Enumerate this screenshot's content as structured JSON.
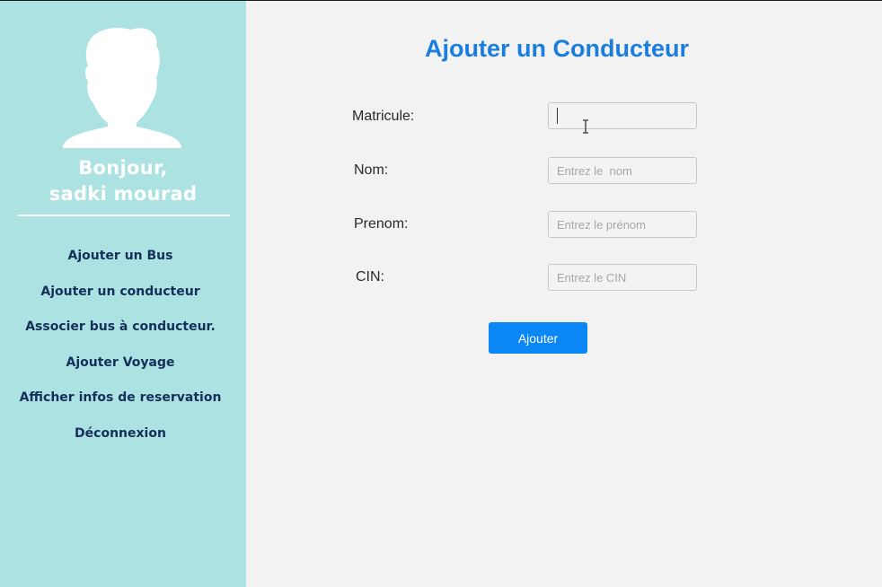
{
  "sidebar": {
    "avatar_icon": "user-silhouette-icon",
    "greeting_line1": "Bonjour,",
    "greeting_line2": "sadki mourad",
    "items": [
      {
        "label": "Ajouter un Bus"
      },
      {
        "label": "Ajouter un conducteur"
      },
      {
        "label": "Associer bus à conducteur."
      },
      {
        "label": "Ajouter Voyage"
      },
      {
        "label": "Afficher infos de reservation"
      },
      {
        "label": "Déconnexion"
      }
    ]
  },
  "form": {
    "title": "Ajouter un Conducteur",
    "fields": [
      {
        "label": "Matricule:",
        "value": "",
        "placeholder": ""
      },
      {
        "label": "Nom:",
        "value": "",
        "placeholder": "Entrez le  nom"
      },
      {
        "label": "Prenom:",
        "value": "",
        "placeholder": "Entrez le prénom"
      },
      {
        "label": "CIN:",
        "value": "",
        "placeholder": "Entrez le CIN"
      }
    ],
    "submit_label": "Ajouter"
  },
  "colors": {
    "sidebar_bg": "#ade2e2",
    "nav_text": "#14305a",
    "title": "#1a7de0",
    "button": "#0b86f7",
    "page_bg": "#f2f2f2"
  }
}
